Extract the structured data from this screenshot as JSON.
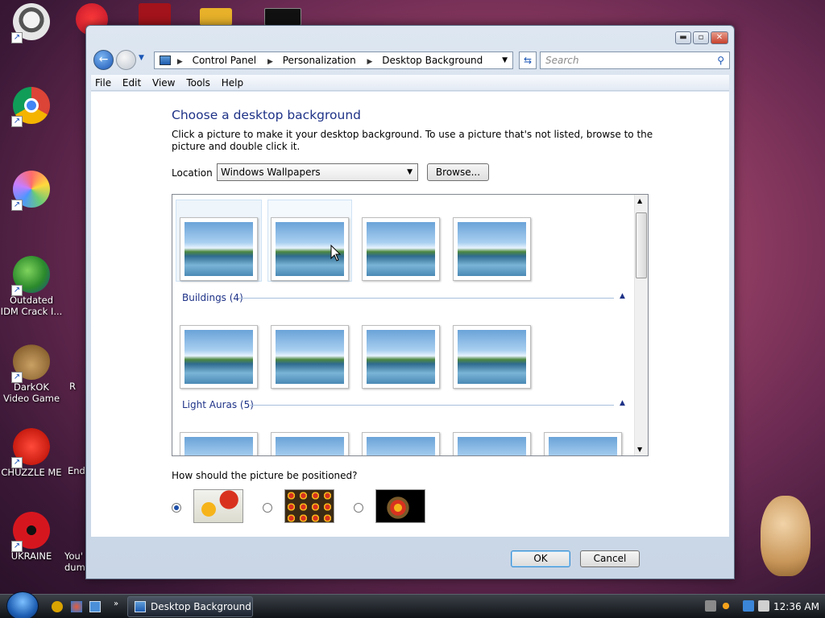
{
  "desktop": {
    "icons": [
      {
        "label": "",
        "icon": "raccoon-icon"
      },
      {
        "label": "",
        "icon": "chrome-icon"
      },
      {
        "label": "",
        "icon": "pinwheel-icon"
      },
      {
        "label": "Outdated IDM Crack I...",
        "icon": "idm-icon"
      },
      {
        "label": "DarkOK Video Game",
        "icon": "money-bag-icon"
      },
      {
        "label": "CHUZZLE ME",
        "icon": "chuzzle-icon"
      },
      {
        "label": "UKRAINE",
        "icon": "radiation-icon"
      }
    ],
    "partial_labels": [
      "R",
      "End",
      "You' dum"
    ]
  },
  "window": {
    "address": {
      "crumbs": [
        "Control Panel",
        "Personalization",
        "Desktop Background"
      ]
    },
    "search_placeholder": "Search",
    "menu": [
      "File",
      "Edit",
      "View",
      "Tools",
      "Help"
    ],
    "title": "Choose a desktop background",
    "description": "Click a picture to make it your desktop background. To use a picture that's not listed, browse to the picture and double click it.",
    "location_label": "Location",
    "location_value": "Windows Wallpapers",
    "browse_label": "Browse...",
    "groups": [
      {
        "name": "",
        "count": 4
      },
      {
        "name": "Buildings (4)",
        "count": 4
      },
      {
        "name": "Light Auras (5)",
        "count": 5
      }
    ],
    "position_label": "How should the picture be positioned?",
    "position_options": [
      "fit",
      "tile",
      "center"
    ],
    "position_selected": 0,
    "ok_label": "OK",
    "cancel_label": "Cancel",
    "min_label": "▬",
    "max_label": "▫",
    "close_label": "✕"
  },
  "taskbar": {
    "task_label": "Desktop Background",
    "clock": "12:36 AM"
  }
}
